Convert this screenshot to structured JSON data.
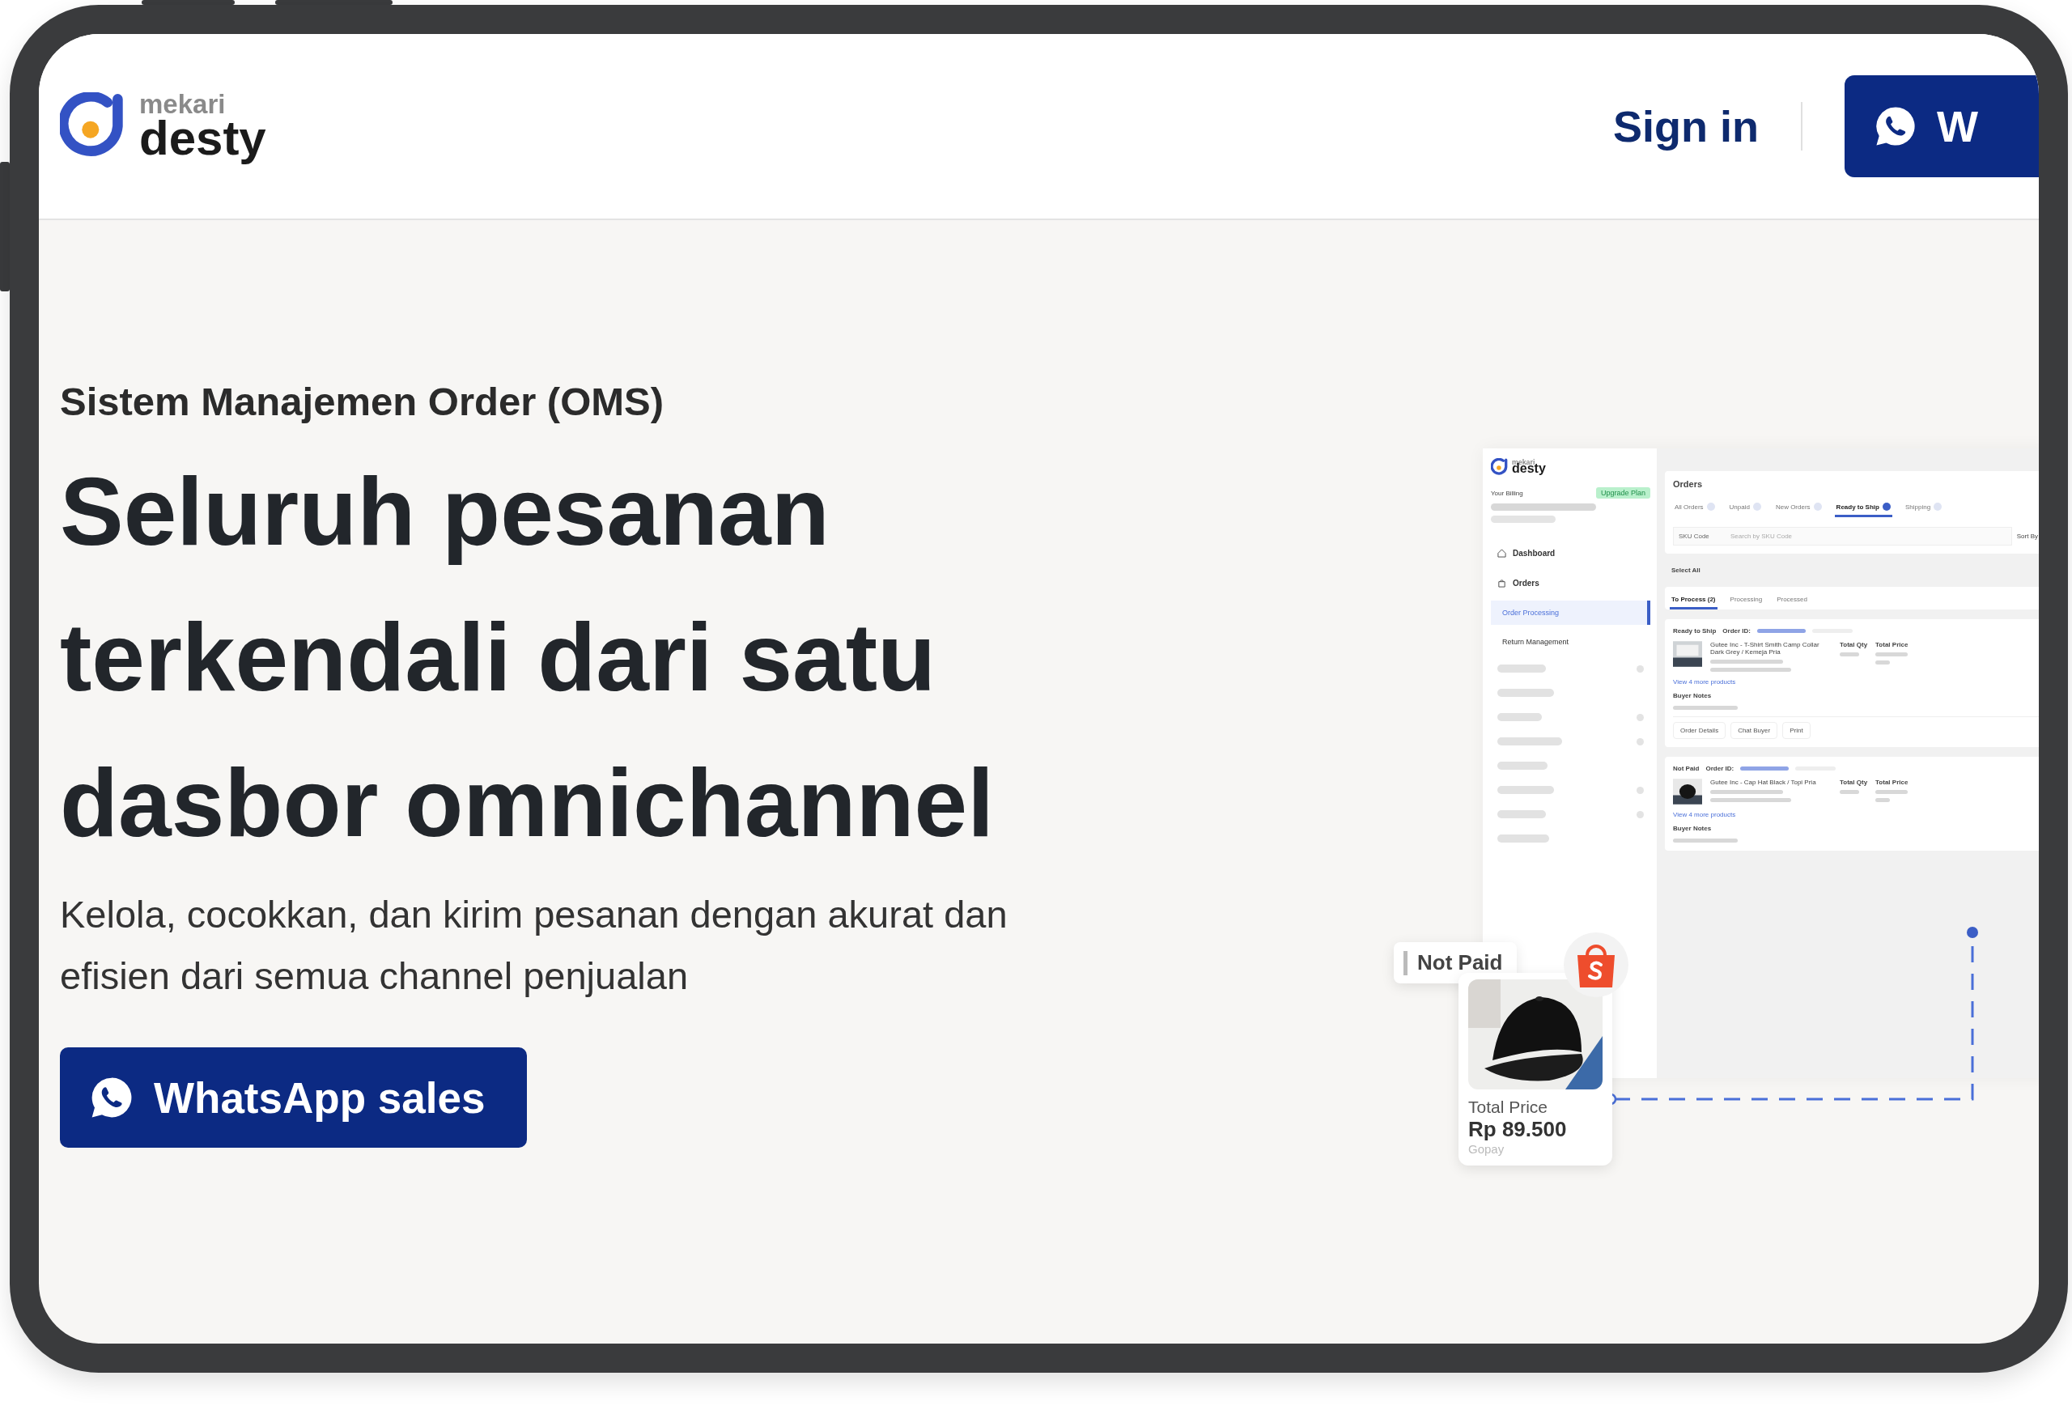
{
  "header": {
    "logo": {
      "brand": "mekari",
      "product": "desty"
    },
    "sign_in": "Sign in",
    "whatsapp_button": "W"
  },
  "hero": {
    "eyebrow": "Sistem Manajemen Order (OMS)",
    "headline_lines": [
      "Seluruh pesanan",
      "terkendali dari satu",
      "dasbor omnichannel"
    ],
    "description_lines": [
      "Kelola, cocokkan, dan kirim pesanan dengan akurat dan",
      "efisien dari semua channel penjualan"
    ],
    "cta": "WhatsApp sales"
  },
  "dashboard_preview": {
    "logo": {
      "brand": "mekari",
      "product": "desty"
    },
    "billing_label": "Your Billing",
    "billing_badge": "Upgrade Plan",
    "nav": [
      {
        "label": "Dashboard",
        "kind": "home",
        "selected": false
      },
      {
        "label": "Orders",
        "kind": "bag",
        "selected": false
      },
      {
        "label": "Order Processing",
        "kind": "sub",
        "selected": true
      },
      {
        "label": "Return Management",
        "kind": "sub",
        "selected": false
      }
    ],
    "title": "Orders",
    "status_tabs": [
      {
        "label": "All Orders",
        "selected": false
      },
      {
        "label": "Unpaid",
        "selected": false
      },
      {
        "label": "New Orders",
        "selected": false
      },
      {
        "label": "Ready to Ship",
        "selected": true
      },
      {
        "label": "Shipping",
        "selected": false
      }
    ],
    "search_select": "SKU Code",
    "search_placeholder": "Search by SKU Code",
    "sort": "Sort By",
    "select_all": "Select All",
    "process_tabs": [
      {
        "label": "To Process (2)",
        "selected": true
      },
      {
        "label": "Processing",
        "selected": false
      },
      {
        "label": "Processed",
        "selected": false
      }
    ],
    "orders": [
      {
        "status": "Ready to Ship",
        "order_id_label": "Order ID:",
        "product": "Gutee Inc - T-Shirt Smith Camp Collar Dark Grey / Kemeja Pria",
        "qty_header": "Total Qty",
        "price_header": "Total Price",
        "more": "View 4 more products",
        "notes": "Buyer Notes",
        "actions": [
          "Order Details",
          "Chat Buyer",
          "Print"
        ]
      },
      {
        "status": "Not Paid",
        "order_id_label": "Order ID:",
        "product": "Gutee Inc - Cap Hat Black / Topi Pria",
        "qty_header": "Total Qty",
        "price_header": "Total Price",
        "more": "View 4 more products",
        "notes": "Buyer Notes"
      }
    ],
    "floating_card": {
      "status": "Not Paid",
      "price_label": "Total Price",
      "price": "Rp 89.500",
      "payment": "Gopay"
    }
  }
}
